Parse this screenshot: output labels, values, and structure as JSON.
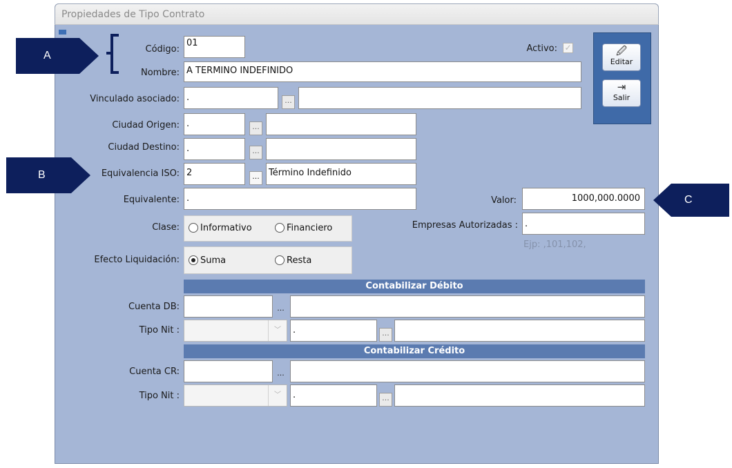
{
  "window": {
    "title": "Propiedades de Tipo Contrato"
  },
  "callouts": {
    "a": "A",
    "b": "B",
    "c": "C"
  },
  "fields": {
    "codigo": {
      "label": "Código:",
      "value": "01"
    },
    "nombre": {
      "label": "Nombre:",
      "value": "A TERMINO INDEFINIDO"
    },
    "activo": {
      "label": "Activo:"
    },
    "vinculado": {
      "label": "Vinculado asociado:",
      "code": ".",
      "desc": ""
    },
    "ciudad_origen": {
      "label": "Ciudad Origen:",
      "code": ".",
      "desc": ""
    },
    "ciudad_destino": {
      "label": "Ciudad Destino:",
      "code": ".",
      "desc": ""
    },
    "equivalencia_iso": {
      "label": "Equivalencia ISO:",
      "code": "2",
      "desc": "Término Indefinido"
    },
    "equivalente": {
      "label": "Equivalente:",
      "value": "."
    },
    "valor": {
      "label": "Valor:",
      "value": "1000,000.0000"
    },
    "empresas": {
      "label": "Empresas Autorizadas :",
      "value": ".",
      "hint": "Ejp: ,101,102,"
    },
    "clase": {
      "label": "Clase:",
      "options": [
        "Informativo",
        "Financiero"
      ]
    },
    "efecto": {
      "label": "Efecto Liquidación:",
      "options": [
        "Suma",
        "Resta"
      ],
      "selected": "Suma"
    }
  },
  "debito": {
    "header": "Contabilizar Débito",
    "cuenta_label": "Cuenta DB:",
    "tipo_label": "Tipo Nit :",
    "tipo_code": "."
  },
  "credito": {
    "header": "Contabilizar Crédito",
    "cuenta_label": "Cuenta CR:",
    "tipo_label": "Tipo Nit :",
    "tipo_code": "."
  },
  "lookup_button": "...",
  "toolbar": {
    "editar": {
      "label": "Editar",
      "icon": "edit-icon"
    },
    "salir": {
      "label": "Salir",
      "icon": "exit-icon"
    }
  },
  "colors": {
    "callout": "#0d1f5c",
    "window_bg": "#a5b6d6",
    "section_header": "#5b7bb0",
    "side_panel": "#3f6aa8"
  }
}
